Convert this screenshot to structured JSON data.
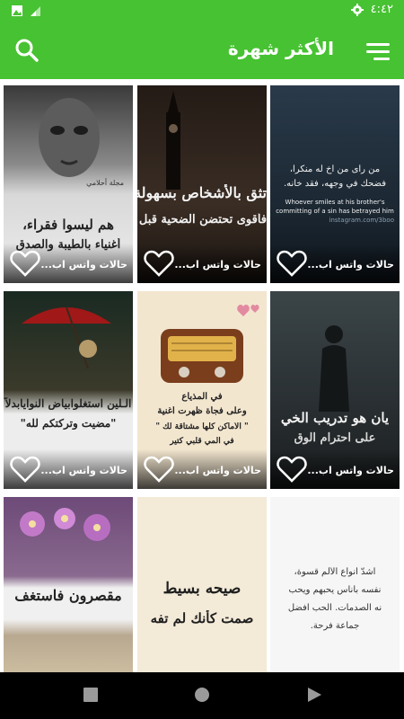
{
  "status_bar": {
    "time": "٤:٤٢",
    "icons": [
      "photo-icon",
      "signal-icon",
      "settings-icon"
    ]
  },
  "app_bar": {
    "title": "الأكثر شهرة",
    "icons": [
      "search-icon",
      "menu-icon"
    ]
  },
  "colors": {
    "brand": "#47c232",
    "nav": "#000000"
  },
  "cards": [
    {
      "caption": "حالات واتس اب...",
      "quote_lines": [
        "هم ليسوا فقراء،",
        "أغنياء بالطيبة والصدق"
      ],
      "watermark": "مجلة أحلامي"
    },
    {
      "caption": "حالات واتس اب...",
      "quote_lines": [
        "تثق بالأشخاص بسهولة",
        "فأقوى تحتضن الضحية قبل إفتراسها"
      ],
      "watermark": ""
    },
    {
      "caption": "حالات واتس اب...",
      "quote_lines": [
        "من رأى من أخ له منكرا،",
        "فضحك في وجهه، فقد خانه.",
        "Whoever smiles at his brother's",
        "committing of a sin has betrayed him"
      ],
      "watermark": "instagram.com/3boo"
    },
    {
      "caption": "حالات واتس اب...",
      "quote_lines": [
        "الـلين استغلوابياض النوايابدلاً",
        "\"مضيت وتركتكم لله\""
      ],
      "watermark": ""
    },
    {
      "caption": "حالات واتس اب...",
      "quote_lines": [
        "في المذياع",
        "وعلى فجأة ظهرت أغنية",
        "\" الأماكن كلها مشتاقة لك \"",
        "في المي قلبي كتير"
      ],
      "watermark": ""
    },
    {
      "caption": "حالات واتس اب...",
      "quote_lines": [
        "يان هو تدريب الخي",
        "على احترام الوق"
      ],
      "watermark": ""
    },
    {
      "caption": "",
      "quote_lines": [
        "مقصرون فاستغف"
      ],
      "watermark": ""
    },
    {
      "caption": "",
      "quote_lines": [
        "صيحه بسيط",
        "صمت كأنك لم تفه"
      ],
      "watermark": ""
    },
    {
      "caption": "",
      "quote_lines": [
        "أشدّ أنواع الألم قسوة،",
        "نفسه بأناس يحبهم ويحب",
        "نه الصدمات. الحب أفضل",
        "جماعة فرحة."
      ],
      "watermark": ""
    }
  ],
  "nav_bar": {
    "icons": [
      "recents-icon",
      "home-icon",
      "back-icon"
    ]
  }
}
